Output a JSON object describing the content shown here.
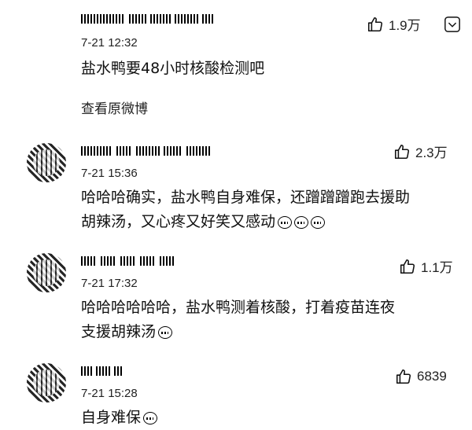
{
  "comments": [
    {
      "time": "7-21 12:32",
      "text": "盐水鸭要48小时核酸检测吧",
      "likes": "1.9万",
      "view_original": "查看原微博"
    },
    {
      "time": "7-21 15:36",
      "text_line1": "哈哈哈确实，盐水鸭自身难保，还蹭蹭蹭跑去援助",
      "text_line2": "胡辣汤，又心疼又好笑又感动",
      "likes": "2.3万",
      "emoji_count": 3
    },
    {
      "time": "7-21 17:32",
      "text_line1": "哈哈哈哈哈哈，盐水鸭测着核酸，打着疫苗连夜",
      "text_line2": "支援胡辣汤",
      "likes": "1.1万",
      "emoji_count": 1
    },
    {
      "time": "7-21 15:28",
      "text": "自身难保",
      "likes": "6839",
      "emoji_count": 1
    }
  ],
  "icons": {
    "like": "thumbs-up-icon",
    "more": "chevron-down-icon"
  }
}
